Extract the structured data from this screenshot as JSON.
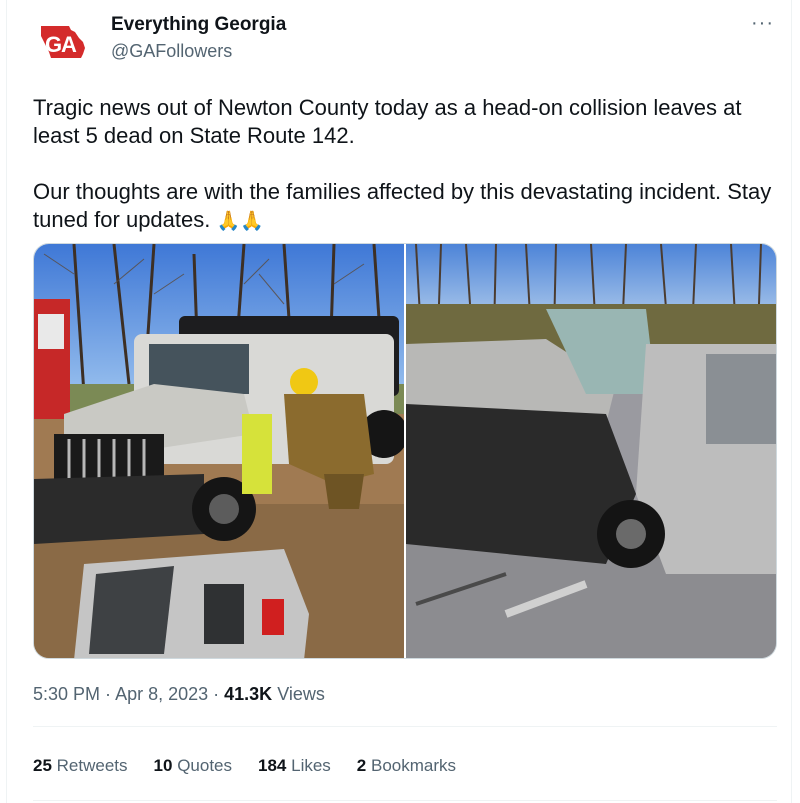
{
  "author": {
    "display_name": "Everything Georgia",
    "handle": "@GAFollowers",
    "avatar_icon": "georgia-state-logo-icon",
    "avatar_color": "#d42b2b"
  },
  "more_icon": "more-options-icon",
  "more_label": "···",
  "tweet": {
    "line1": "Tragic news out of Newton County today as a head-on collision leaves at least 5 dead on State Route 142.",
    "line2": "Our thoughts are with the families affected by this devastating incident. Stay tuned for updates.",
    "emoji": "🙏🙏",
    "emoji_icon": "folded-hands-icon"
  },
  "media": [
    {
      "name": "jeep-crash-photo"
    },
    {
      "name": "pickup-crash-photo"
    }
  ],
  "meta": {
    "time": "5:30 PM",
    "sep1": " · ",
    "date": "Apr 8, 2023",
    "sep2": " · ",
    "views_count": "41.3K",
    "views_label": " Views"
  },
  "stats": {
    "retweets_count": "25",
    "retweets_label": "Retweets",
    "quotes_count": "10",
    "quotes_label": "Quotes",
    "likes_count": "184",
    "likes_label": "Likes",
    "bookmarks_count": "2",
    "bookmarks_label": "Bookmarks"
  },
  "colors": {
    "text": "#0f1419",
    "secondary": "#536471",
    "divider": "#eff3f4"
  }
}
